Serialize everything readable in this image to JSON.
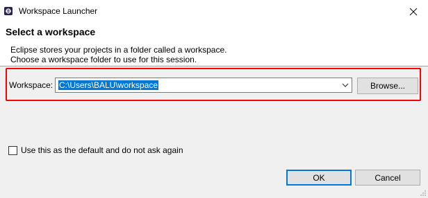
{
  "window": {
    "title": "Workspace Launcher",
    "app_icon": "eclipse-icon",
    "close_icon": "close-icon"
  },
  "header": {
    "title": "Select a workspace",
    "description_line1": "Eclipse stores your projects in a folder called a workspace.",
    "description_line2": "Choose a workspace folder to use for this session."
  },
  "workspace": {
    "label": "Workspace:",
    "value": "C:\\Users\\BALU\\workspace",
    "dropdown_icon": "chevron-down-icon",
    "browse_label": "Browse...",
    "highlight_color": "#ff0000"
  },
  "default_option": {
    "label": "Use this as the default and do not ask again",
    "checked": false
  },
  "buttons": {
    "ok_label": "OK",
    "cancel_label": "Cancel"
  },
  "colors": {
    "selection": "#0078d7",
    "dialog_background": "#f0f0f0"
  }
}
